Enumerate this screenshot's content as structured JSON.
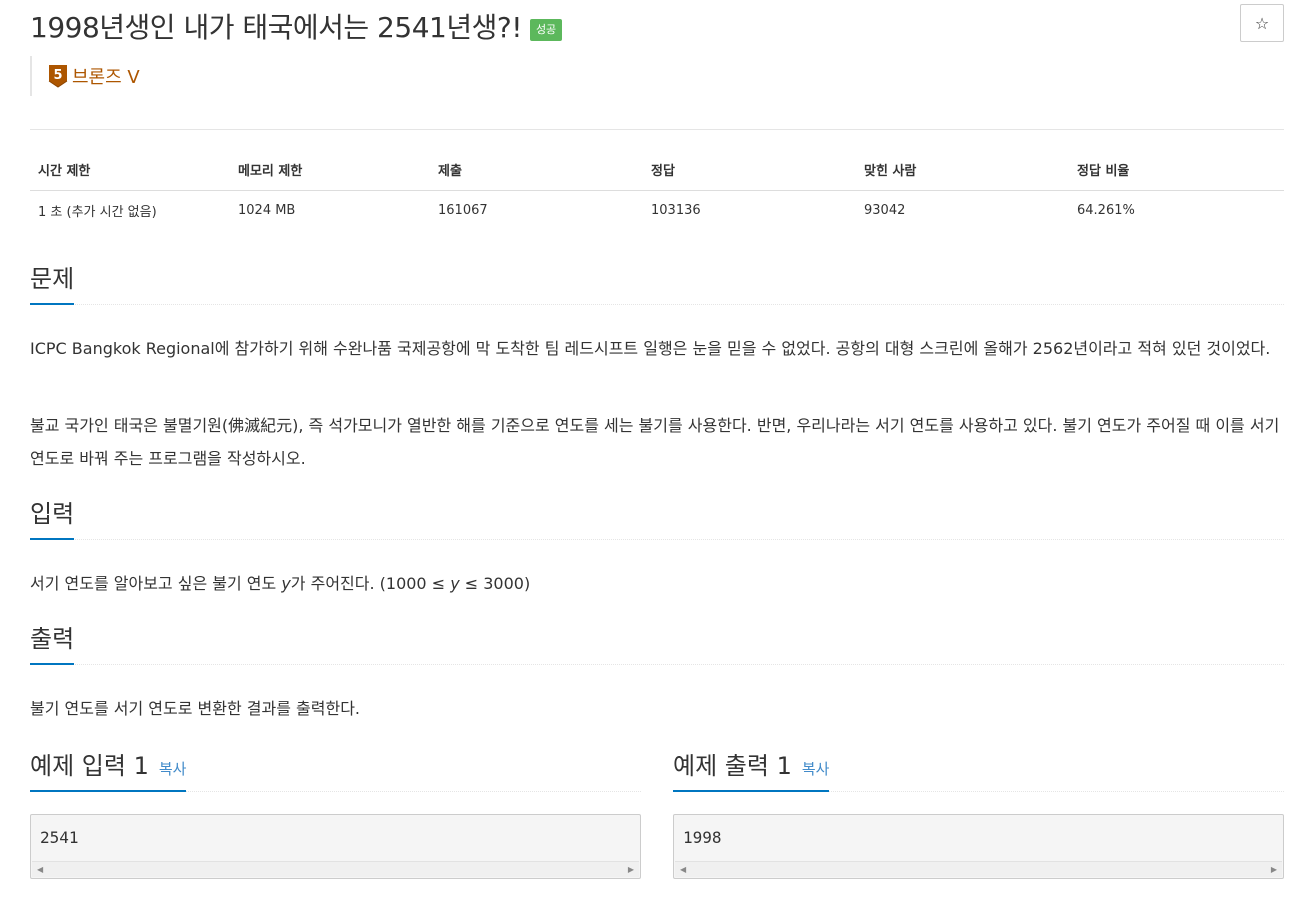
{
  "problem": {
    "title": "1998년생인 내가 태국에서는 2541년생?!",
    "status_badge": "성공",
    "star_icon": "☆",
    "tier": {
      "level": "5",
      "name": "브론즈 V",
      "color": "#ad5600"
    }
  },
  "info_table": {
    "headers": [
      "시간 제한",
      "메모리 제한",
      "제출",
      "정답",
      "맞힌 사람",
      "정답 비율"
    ],
    "values": [
      "1 초 (추가 시간 없음)",
      "1024 MB",
      "161067",
      "103136",
      "93042",
      "64.261%"
    ]
  },
  "description": {
    "heading": "문제",
    "paragraph1": "ICPC Bangkok Regional에 참가하기 위해 수완나품 국제공항에 막 도착한 팀 레드시프트 일행은 눈을 믿을 수 없었다. 공항의 대형 스크린에 올해가 2562년이라고 적혀 있던 것이었다.",
    "paragraph2": "불교 국가인 태국은 불멸기원(佛滅紀元), 즉 석가모니가 열반한 해를 기준으로 연도를 세는 불기를 사용한다. 반면, 우리나라는 서기 연도를 사용하고 있다. 불기 연도가 주어질 때 이를 서기 연도로 바꿔 주는 프로그램을 작성하시오."
  },
  "input": {
    "heading": "입력",
    "text_before": "서기 연도를 알아보고 싶은 불기 연도 ",
    "var": "y",
    "text_after": "가 주어진다. (1000 ≤ ",
    "var2": "y",
    "text_end": " ≤ 3000)"
  },
  "output": {
    "heading": "출력",
    "text": "불기 연도를 서기 연도로 변환한 결과를 출력한다."
  },
  "samples": {
    "input_heading": "예제 입력 1",
    "output_heading": "예제 출력 1",
    "copy_label": "복사",
    "input_value": "2541",
    "output_value": "1998"
  },
  "colors": {
    "accent": "#0076c0",
    "success": "#5cb85c",
    "link": "#428bca"
  }
}
